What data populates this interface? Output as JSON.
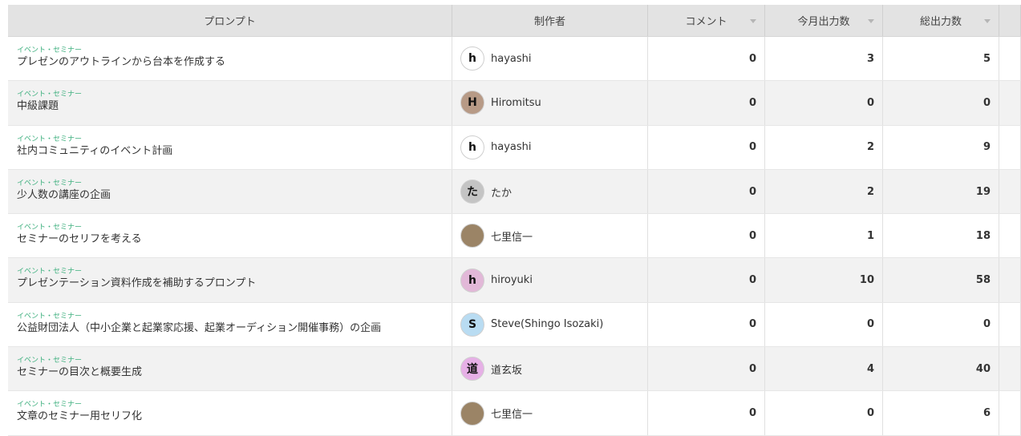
{
  "headers": {
    "prompt": "プロンプト",
    "author": "制作者",
    "comment": "コメント",
    "month": "今月出力数",
    "total": "総出力数"
  },
  "rows": [
    {
      "category": "イベント・セミナー",
      "title": "プレゼンのアウトラインから台本を作成する",
      "avatar_letter": "h",
      "avatar_bg": "#ffffff",
      "author": "hayashi",
      "comment": "0",
      "month": "3",
      "total": "5"
    },
    {
      "category": "イベント・セミナー",
      "title": "中級課題",
      "avatar_letter": "H",
      "avatar_bg": "#b79a86",
      "author": "Hiromitsu",
      "comment": "0",
      "month": "0",
      "total": "0"
    },
    {
      "category": "イベント・セミナー",
      "title": "社内コミュニティのイベント計画",
      "avatar_letter": "h",
      "avatar_bg": "#ffffff",
      "author": "hayashi",
      "comment": "0",
      "month": "2",
      "total": "9"
    },
    {
      "category": "イベント・セミナー",
      "title": "少人数の講座の企画",
      "avatar_letter": "た",
      "avatar_bg": "#c4c4c4",
      "author": "たか",
      "comment": "0",
      "month": "2",
      "total": "19"
    },
    {
      "category": "イベント・セミナー",
      "title": "セミナーのセリフを考える",
      "avatar_letter": "",
      "avatar_bg": "#9b8466",
      "author": "七里信一",
      "comment": "0",
      "month": "1",
      "total": "18"
    },
    {
      "category": "イベント・セミナー",
      "title": "プレゼンテーション資料作成を補助するプロンプト",
      "avatar_letter": "h",
      "avatar_bg": "#e2b8d8",
      "author": "hiroyuki",
      "comment": "0",
      "month": "10",
      "total": "58"
    },
    {
      "category": "イベント・セミナー",
      "title": "公益財団法人（中小企業と起業家応援、起業オーディション開催事務）の企画",
      "avatar_letter": "S",
      "avatar_bg": "#b9dcf2",
      "author": "Steve(Shingo Isozaki)",
      "comment": "0",
      "month": "0",
      "total": "0"
    },
    {
      "category": "イベント・セミナー",
      "title": "セミナーの目次と概要生成",
      "avatar_letter": "道",
      "avatar_bg": "#e6b0e6",
      "author": "道玄坂",
      "comment": "0",
      "month": "4",
      "total": "40"
    },
    {
      "category": "イベント・セミナー",
      "title": "文章のセミナー用セリフ化",
      "avatar_letter": "",
      "avatar_bg": "#9b8466",
      "author": "七里信一",
      "comment": "0",
      "month": "0",
      "total": "6"
    }
  ]
}
